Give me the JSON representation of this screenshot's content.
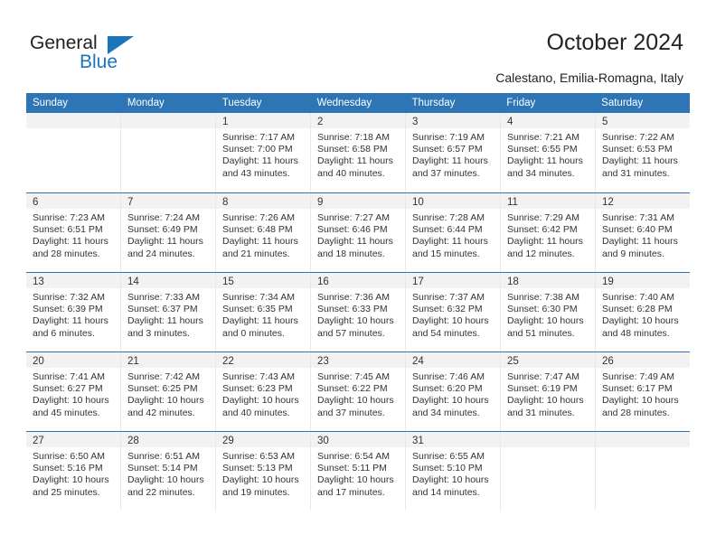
{
  "brand": {
    "name_part1": "General",
    "name_part2": "Blue",
    "accent_color": "#1b75bb"
  },
  "header": {
    "title": "October 2024",
    "location": "Calestano, Emilia-Romagna, Italy"
  },
  "calendar": {
    "header_color": "#2e75b6",
    "weekdays": [
      "Sunday",
      "Monday",
      "Tuesday",
      "Wednesday",
      "Thursday",
      "Friday",
      "Saturday"
    ],
    "weeks": [
      [
        {
          "day": "",
          "empty": true
        },
        {
          "day": "",
          "empty": true
        },
        {
          "day": "1",
          "sunrise": "Sunrise: 7:17 AM",
          "sunset": "Sunset: 7:00 PM",
          "daylight1": "Daylight: 11 hours",
          "daylight2": "and 43 minutes."
        },
        {
          "day": "2",
          "sunrise": "Sunrise: 7:18 AM",
          "sunset": "Sunset: 6:58 PM",
          "daylight1": "Daylight: 11 hours",
          "daylight2": "and 40 minutes."
        },
        {
          "day": "3",
          "sunrise": "Sunrise: 7:19 AM",
          "sunset": "Sunset: 6:57 PM",
          "daylight1": "Daylight: 11 hours",
          "daylight2": "and 37 minutes."
        },
        {
          "day": "4",
          "sunrise": "Sunrise: 7:21 AM",
          "sunset": "Sunset: 6:55 PM",
          "daylight1": "Daylight: 11 hours",
          "daylight2": "and 34 minutes."
        },
        {
          "day": "5",
          "sunrise": "Sunrise: 7:22 AM",
          "sunset": "Sunset: 6:53 PM",
          "daylight1": "Daylight: 11 hours",
          "daylight2": "and 31 minutes."
        }
      ],
      [
        {
          "day": "6",
          "sunrise": "Sunrise: 7:23 AM",
          "sunset": "Sunset: 6:51 PM",
          "daylight1": "Daylight: 11 hours",
          "daylight2": "and 28 minutes."
        },
        {
          "day": "7",
          "sunrise": "Sunrise: 7:24 AM",
          "sunset": "Sunset: 6:49 PM",
          "daylight1": "Daylight: 11 hours",
          "daylight2": "and 24 minutes."
        },
        {
          "day": "8",
          "sunrise": "Sunrise: 7:26 AM",
          "sunset": "Sunset: 6:48 PM",
          "daylight1": "Daylight: 11 hours",
          "daylight2": "and 21 minutes."
        },
        {
          "day": "9",
          "sunrise": "Sunrise: 7:27 AM",
          "sunset": "Sunset: 6:46 PM",
          "daylight1": "Daylight: 11 hours",
          "daylight2": "and 18 minutes."
        },
        {
          "day": "10",
          "sunrise": "Sunrise: 7:28 AM",
          "sunset": "Sunset: 6:44 PM",
          "daylight1": "Daylight: 11 hours",
          "daylight2": "and 15 minutes."
        },
        {
          "day": "11",
          "sunrise": "Sunrise: 7:29 AM",
          "sunset": "Sunset: 6:42 PM",
          "daylight1": "Daylight: 11 hours",
          "daylight2": "and 12 minutes."
        },
        {
          "day": "12",
          "sunrise": "Sunrise: 7:31 AM",
          "sunset": "Sunset: 6:40 PM",
          "daylight1": "Daylight: 11 hours",
          "daylight2": "and 9 minutes."
        }
      ],
      [
        {
          "day": "13",
          "sunrise": "Sunrise: 7:32 AM",
          "sunset": "Sunset: 6:39 PM",
          "daylight1": "Daylight: 11 hours",
          "daylight2": "and 6 minutes."
        },
        {
          "day": "14",
          "sunrise": "Sunrise: 7:33 AM",
          "sunset": "Sunset: 6:37 PM",
          "daylight1": "Daylight: 11 hours",
          "daylight2": "and 3 minutes."
        },
        {
          "day": "15",
          "sunrise": "Sunrise: 7:34 AM",
          "sunset": "Sunset: 6:35 PM",
          "daylight1": "Daylight: 11 hours",
          "daylight2": "and 0 minutes."
        },
        {
          "day": "16",
          "sunrise": "Sunrise: 7:36 AM",
          "sunset": "Sunset: 6:33 PM",
          "daylight1": "Daylight: 10 hours",
          "daylight2": "and 57 minutes."
        },
        {
          "day": "17",
          "sunrise": "Sunrise: 7:37 AM",
          "sunset": "Sunset: 6:32 PM",
          "daylight1": "Daylight: 10 hours",
          "daylight2": "and 54 minutes."
        },
        {
          "day": "18",
          "sunrise": "Sunrise: 7:38 AM",
          "sunset": "Sunset: 6:30 PM",
          "daylight1": "Daylight: 10 hours",
          "daylight2": "and 51 minutes."
        },
        {
          "day": "19",
          "sunrise": "Sunrise: 7:40 AM",
          "sunset": "Sunset: 6:28 PM",
          "daylight1": "Daylight: 10 hours",
          "daylight2": "and 48 minutes."
        }
      ],
      [
        {
          "day": "20",
          "sunrise": "Sunrise: 7:41 AM",
          "sunset": "Sunset: 6:27 PM",
          "daylight1": "Daylight: 10 hours",
          "daylight2": "and 45 minutes."
        },
        {
          "day": "21",
          "sunrise": "Sunrise: 7:42 AM",
          "sunset": "Sunset: 6:25 PM",
          "daylight1": "Daylight: 10 hours",
          "daylight2": "and 42 minutes."
        },
        {
          "day": "22",
          "sunrise": "Sunrise: 7:43 AM",
          "sunset": "Sunset: 6:23 PM",
          "daylight1": "Daylight: 10 hours",
          "daylight2": "and 40 minutes."
        },
        {
          "day": "23",
          "sunrise": "Sunrise: 7:45 AM",
          "sunset": "Sunset: 6:22 PM",
          "daylight1": "Daylight: 10 hours",
          "daylight2": "and 37 minutes."
        },
        {
          "day": "24",
          "sunrise": "Sunrise: 7:46 AM",
          "sunset": "Sunset: 6:20 PM",
          "daylight1": "Daylight: 10 hours",
          "daylight2": "and 34 minutes."
        },
        {
          "day": "25",
          "sunrise": "Sunrise: 7:47 AM",
          "sunset": "Sunset: 6:19 PM",
          "daylight1": "Daylight: 10 hours",
          "daylight2": "and 31 minutes."
        },
        {
          "day": "26",
          "sunrise": "Sunrise: 7:49 AM",
          "sunset": "Sunset: 6:17 PM",
          "daylight1": "Daylight: 10 hours",
          "daylight2": "and 28 minutes."
        }
      ],
      [
        {
          "day": "27",
          "sunrise": "Sunrise: 6:50 AM",
          "sunset": "Sunset: 5:16 PM",
          "daylight1": "Daylight: 10 hours",
          "daylight2": "and 25 minutes."
        },
        {
          "day": "28",
          "sunrise": "Sunrise: 6:51 AM",
          "sunset": "Sunset: 5:14 PM",
          "daylight1": "Daylight: 10 hours",
          "daylight2": "and 22 minutes."
        },
        {
          "day": "29",
          "sunrise": "Sunrise: 6:53 AM",
          "sunset": "Sunset: 5:13 PM",
          "daylight1": "Daylight: 10 hours",
          "daylight2": "and 19 minutes."
        },
        {
          "day": "30",
          "sunrise": "Sunrise: 6:54 AM",
          "sunset": "Sunset: 5:11 PM",
          "daylight1": "Daylight: 10 hours",
          "daylight2": "and 17 minutes."
        },
        {
          "day": "31",
          "sunrise": "Sunrise: 6:55 AM",
          "sunset": "Sunset: 5:10 PM",
          "daylight1": "Daylight: 10 hours",
          "daylight2": "and 14 minutes."
        },
        {
          "day": "",
          "empty": true
        },
        {
          "day": "",
          "empty": true
        }
      ]
    ]
  }
}
